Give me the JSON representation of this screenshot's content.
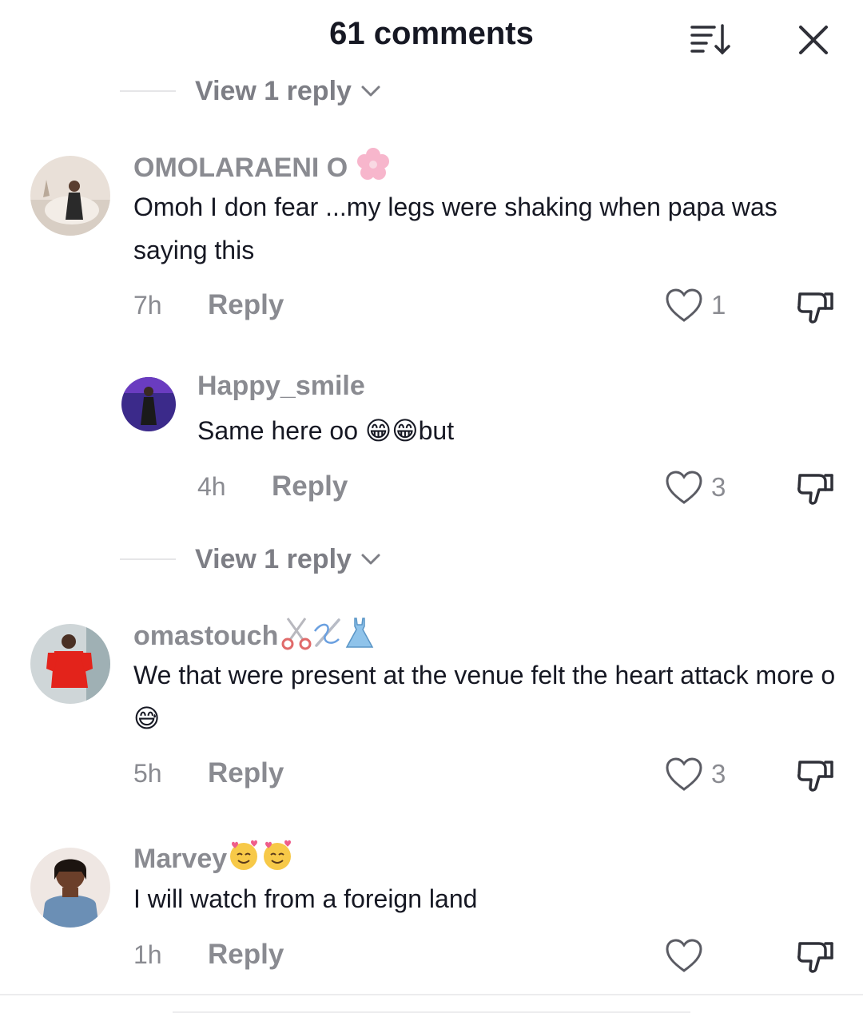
{
  "header": {
    "title": "61 comments",
    "sort_icon": "sort-icon",
    "close_icon": "close-icon"
  },
  "view_replies_top": {
    "label": "View 1 reply"
  },
  "view_replies_mid": {
    "label": "View 1 reply"
  },
  "comments": [
    {
      "username": "OMOLARAENI O",
      "username_emoji": "🌸",
      "text": "Omoh I don fear ...my legs were shaking when papa was saying this",
      "time": "7h",
      "reply_label": "Reply",
      "likes": "1"
    },
    {
      "username": "Happy_smile",
      "text": "Same here oo 😁😁but",
      "time": "4h",
      "reply_label": "Reply",
      "likes": "3"
    },
    {
      "username": "omastouch",
      "username_emoji": "✂️🪡👗",
      "text": "We that were present at the venue felt the heart attack more o 😅",
      "time": "5h",
      "reply_label": "Reply",
      "likes": "3"
    },
    {
      "username": "Marvey",
      "username_emoji": "🥰🥰",
      "text": "I will watch from a foreign land",
      "time": "1h",
      "reply_label": "Reply",
      "likes": ""
    }
  ],
  "colors": {
    "primary_text": "#161823",
    "secondary_text": "#8a8b91",
    "icon": "#2f3038"
  }
}
